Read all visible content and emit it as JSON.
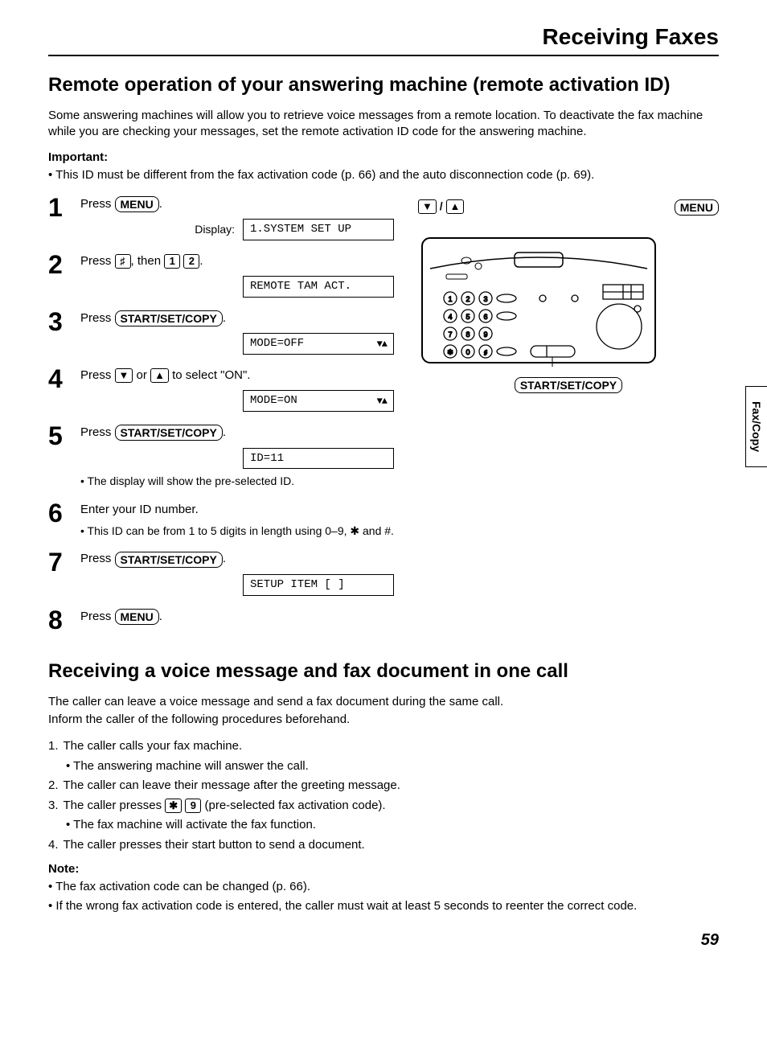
{
  "pageTitle": "Receiving Faxes",
  "section1": {
    "heading": "Remote operation of your answering machine (remote activation ID)",
    "intro": "Some answering machines will allow you to retrieve voice messages from a remote location. To deactivate the fax machine while you are checking your messages, set the remote activation ID code for the answering machine.",
    "importantLabel": "Important:",
    "importantBullet": "This ID must be different from the fax activation code (p. 66) and the auto disconnection code (p. 69)."
  },
  "keys": {
    "menu": "MENU",
    "hash": "♯",
    "one": "1",
    "two": "2",
    "startSetCopy": "START/SET/COPY",
    "down": "▼",
    "up": "▲",
    "star": "✱",
    "nine": "9"
  },
  "steps": [
    {
      "num": "1",
      "textA": "Press ",
      "keycap1": "menu",
      "textB": ".",
      "displayLabel": "Display:",
      "display": "1.SYSTEM SET UP"
    },
    {
      "num": "2",
      "textA": "Press ",
      "keycapSq1": "hash",
      "textB": ", then ",
      "keycapSq2": "one",
      "keycapSq3": "two",
      "textC": ".",
      "display": "REMOTE TAM ACT."
    },
    {
      "num": "3",
      "textA": "Press ",
      "keycap1": "startSetCopy",
      "textB": ".",
      "display": "MODE=OFF",
      "arrows": "▼▲"
    },
    {
      "num": "4",
      "textA": "Press ",
      "keycapSq1": "down",
      "textB": " or ",
      "keycapSq2": "up",
      "textC": " to select \"ON\".",
      "display": "MODE=ON",
      "arrows": "▼▲"
    },
    {
      "num": "5",
      "textA": "Press ",
      "keycap1": "startSetCopy",
      "textB": ".",
      "display": "ID=11",
      "sub": "The display will show the pre-selected ID."
    },
    {
      "num": "6",
      "textA": "Enter your ID number.",
      "sub": "This ID can be from 1 to 5 digits in length using 0–9, ✱ and #."
    },
    {
      "num": "7",
      "textA": "Press ",
      "keycap1": "startSetCopy",
      "textB": ".",
      "display": "SETUP ITEM [  ]"
    },
    {
      "num": "8",
      "textA": "Press ",
      "keycap1": "menu",
      "textB": "."
    }
  ],
  "device": {
    "arrowLabel": "▼ / ▲",
    "menuLabel": "MENU",
    "startSetCopyLabel": "START/SET/COPY"
  },
  "section2": {
    "heading": "Receiving a voice message and fax document in one call",
    "introA": "The caller can leave a voice message and send a fax document during the same call.",
    "introB": "Inform the caller of the following procedures beforehand.",
    "items": [
      {
        "n": "1.",
        "t": "The caller calls your fax machine.",
        "sub": "The answering machine will answer the call."
      },
      {
        "n": "2.",
        "t": "The caller can leave their message after the greeting message."
      },
      {
        "n": "3.",
        "tA": "The caller presses ",
        "k1": "star",
        "k2": "nine",
        "tB": " (pre-selected fax activation code).",
        "sub": "The fax machine will activate the fax function."
      },
      {
        "n": "4.",
        "t": "The caller presses their start button to send a document."
      }
    ],
    "noteLabel": "Note:",
    "notes": [
      "The fax activation code can be changed (p. 66).",
      "If the wrong fax activation code is entered, the caller must wait at least 5 seconds to reenter the correct code."
    ]
  },
  "sideTab": "Fax/Copy",
  "pageNumber": "59"
}
